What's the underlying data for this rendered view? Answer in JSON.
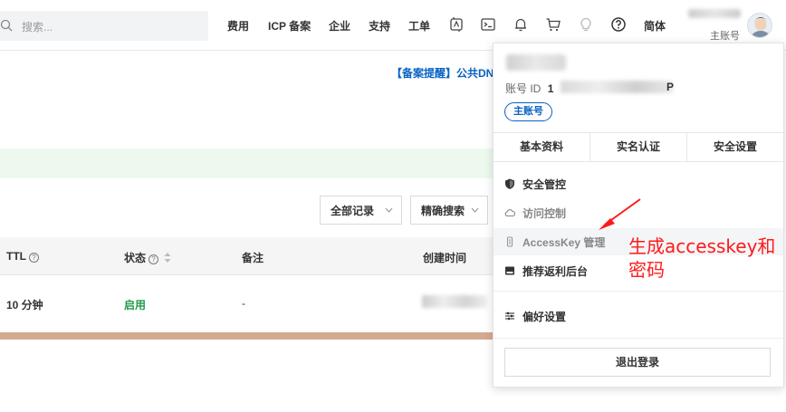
{
  "header": {
    "search_placeholder": "搜索...",
    "nav": [
      "费用",
      "ICP 备案",
      "企业",
      "支持",
      "工单"
    ],
    "icons": [
      "ai-assistant-icon",
      "terminal-icon",
      "bell-icon",
      "cart-icon",
      "lightbulb-icon",
      "help-icon"
    ],
    "language": "简体",
    "account_role": "主账号"
  },
  "main": {
    "notice": "【备案提醒】公共DN",
    "filter_all": "全部记录",
    "filter_precise": "精确搜索",
    "table": {
      "columns": [
        "TTL",
        "状态",
        "备注",
        "创建时间"
      ],
      "rows": [
        {
          "ttl": "10 分钟",
          "status": "启用",
          "remark": "-"
        }
      ]
    }
  },
  "popup": {
    "id_label": "账号 ID",
    "id_prefix": "1",
    "id_suffix": "P",
    "badge": "主账号",
    "tabs": [
      "基本资料",
      "实名认证",
      "安全设置"
    ],
    "items": [
      {
        "label": "安全管控",
        "icon": "shield-icon"
      },
      {
        "label": "访问控制",
        "icon": "cloud-icon"
      },
      {
        "label": "AccessKey 管理",
        "icon": "key-icon"
      },
      {
        "label": "推荐返利后台",
        "icon": "gift-icon"
      },
      {
        "label": "偏好设置",
        "icon": "sliders-icon"
      }
    ],
    "logout": "退出登录"
  },
  "annotation": {
    "text": "生成accesskey和密码",
    "color": "#ff1a1a"
  },
  "colors": {
    "accent": "#0a62c3",
    "status_enabled": "#23994a"
  }
}
